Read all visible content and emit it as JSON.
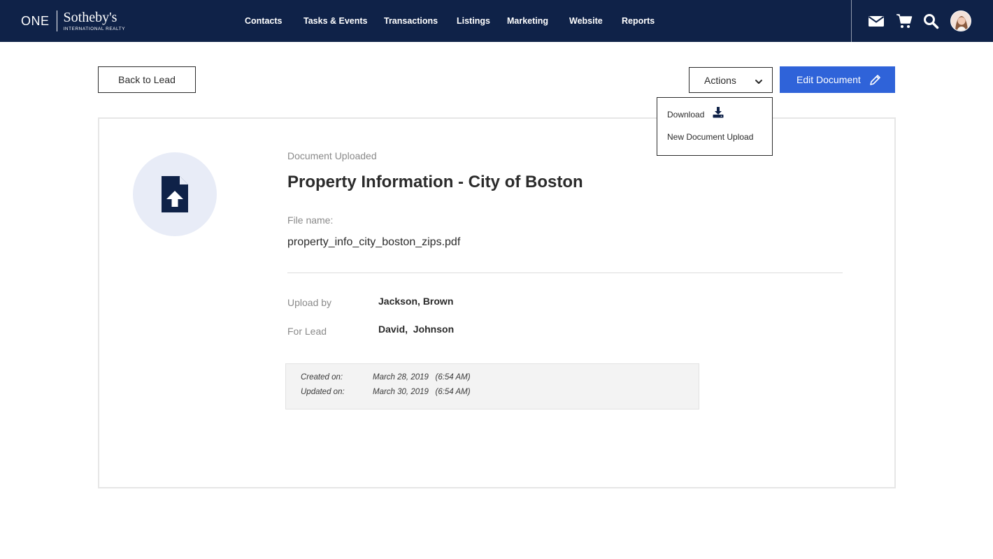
{
  "brand": {
    "one": "ONE",
    "name": "Sotheby's",
    "subtitle": "INTERNATIONAL REALTY"
  },
  "nav": {
    "items": [
      {
        "label": "Contacts"
      },
      {
        "label": "Tasks & Events"
      },
      {
        "label": "Transactions"
      },
      {
        "label": "Listings"
      },
      {
        "label": "Marketing"
      },
      {
        "label": "Website"
      },
      {
        "label": "Reports"
      }
    ],
    "icons": [
      "envelope-icon",
      "cart-icon",
      "search-icon",
      "user-avatar"
    ]
  },
  "toolbar": {
    "back_label": "Back to Lead",
    "actions_label": "Actions",
    "edit_label": "Edit Document"
  },
  "actions_menu": {
    "items": [
      {
        "label": "Download",
        "icon": "download-icon"
      },
      {
        "label": "New Document Upload"
      }
    ]
  },
  "document": {
    "status": "Document Uploaded",
    "title": "Property Information - City of Boston",
    "file_label": "File name:",
    "file_name": "property_info_city_boston_zips.pdf",
    "icon": "file-upload-icon"
  },
  "details": {
    "upload_by_label": "Upload by",
    "upload_by_value": "Jackson, Brown",
    "for_lead_label": "For Lead",
    "for_lead_value": "David,  Johnson"
  },
  "dates": {
    "created_label": "Created on:",
    "created_value": "March 28, 2019   (6:54 AM)",
    "updated_label": "Updated on:",
    "updated_value": "March 30, 2019   (6:54 AM)"
  },
  "colors": {
    "topbar": "#0f2248",
    "primary_button": "#2f63d9",
    "icon_circle": "#e8ecf7"
  }
}
